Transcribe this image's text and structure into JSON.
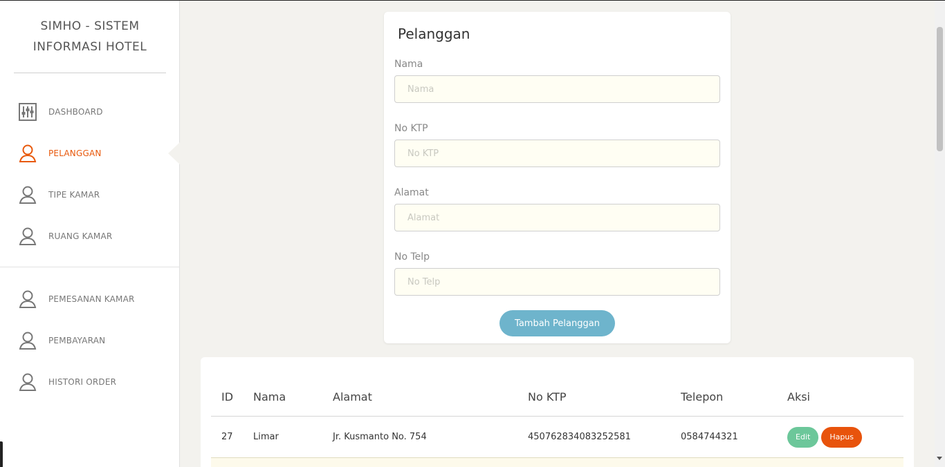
{
  "app": {
    "brand_line1": "SIMHO - SISTEM",
    "brand_line2": "INFORMASI HOTEL"
  },
  "sidebar": {
    "items": [
      {
        "label": "DASHBOARD",
        "icon": "sliders-icon"
      },
      {
        "label": "PELANGGAN",
        "icon": "user-icon",
        "active": true
      },
      {
        "label": "TIPE KAMAR",
        "icon": "user-icon"
      },
      {
        "label": "RUANG KAMAR",
        "icon": "user-icon"
      },
      {
        "label": "PEMESANAN KAMAR",
        "icon": "user-icon"
      },
      {
        "label": "PEMBAYARAN",
        "icon": "user-icon"
      },
      {
        "label": "HISTORI ORDER",
        "icon": "user-icon"
      }
    ]
  },
  "form": {
    "title": "Pelanggan",
    "fields": [
      {
        "label": "Nama",
        "placeholder": "Nama",
        "value": ""
      },
      {
        "label": "No KTP",
        "placeholder": "No KTP",
        "value": ""
      },
      {
        "label": "Alamat",
        "placeholder": "Alamat",
        "value": ""
      },
      {
        "label": "No Telp",
        "placeholder": "No Telp",
        "value": ""
      }
    ],
    "submit_label": "Tambah Pelanggan"
  },
  "table": {
    "columns": [
      "ID",
      "Nama",
      "Alamat",
      "No KTP",
      "Telepon",
      "Aksi"
    ],
    "rows": [
      {
        "id": "27",
        "nama": "Limar",
        "alamat": "Jr. Kusmanto No. 754",
        "no_ktp": "450762834083252581",
        "telepon": "0584744321"
      }
    ],
    "edit_label": "Edit",
    "delete_label": "Hapus"
  },
  "colors": {
    "accent": "#e8590c",
    "primary_button": "#6eb4cc",
    "edit_button": "#6cc79a",
    "delete_button": "#e8530c",
    "page_bg": "#f3f2ee"
  }
}
